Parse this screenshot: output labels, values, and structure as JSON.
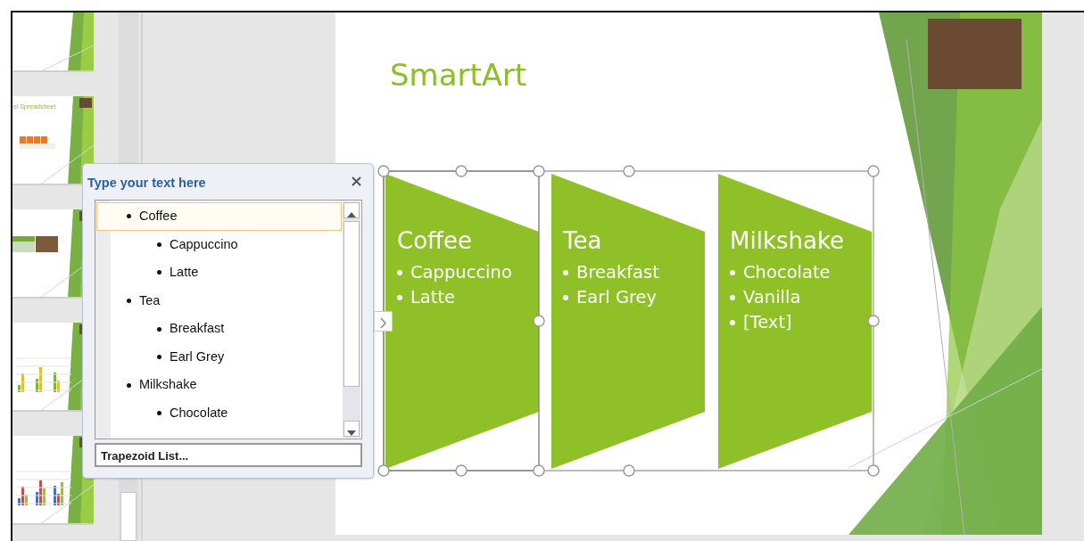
{
  "thumbnails": [
    {
      "kind": "blank"
    },
    {
      "kind": "table",
      "title": "el Spreadsheet"
    },
    {
      "kind": "phototable"
    },
    {
      "kind": "columns"
    },
    {
      "kind": "clusters"
    }
  ],
  "text_pane": {
    "title": "Type your text here",
    "items": [
      {
        "text": "Coffee",
        "selected": true,
        "children": [
          {
            "text": "Cappuccino",
            "selected": false
          },
          {
            "text": "Latte",
            "selected": false
          }
        ]
      },
      {
        "text": "Tea",
        "selected": false,
        "children": [
          {
            "text": "Breakfast",
            "selected": false
          },
          {
            "text": "Earl Grey",
            "selected": false
          }
        ]
      },
      {
        "text": "Milkshake",
        "selected": false,
        "children": [
          {
            "text": "Chocolate",
            "selected": false
          }
        ]
      }
    ],
    "footer": "Trapezoid List..."
  },
  "slide": {
    "title": "SmartArt",
    "smartart": {
      "shapes": [
        {
          "heading": "Coffee",
          "bullets": [
            "Cappuccino",
            "Latte"
          ]
        },
        {
          "heading": "Tea",
          "bullets": [
            "Breakfast",
            "Earl Grey"
          ]
        },
        {
          "heading": "Milkshake",
          "bullets": [
            "Chocolate",
            "Vanilla",
            "[Text]"
          ]
        }
      ]
    }
  }
}
